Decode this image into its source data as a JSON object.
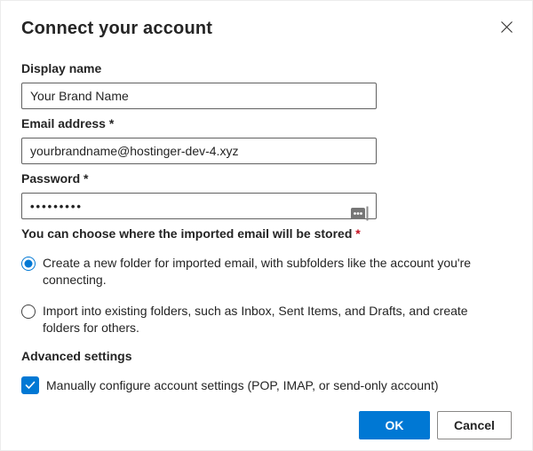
{
  "dialog": {
    "title": "Connect your account"
  },
  "fields": {
    "display_name": {
      "label": "Display name",
      "value": "Your Brand Name"
    },
    "email": {
      "label": "Email address",
      "required_mark": "*",
      "value": "yourbrandname@hostinger-dev-4.xyz"
    },
    "password": {
      "label": "Password",
      "required_mark": "*",
      "value": "•••••••••"
    }
  },
  "storage_section": {
    "heading": "You can choose where the imported email will be stored",
    "required_mark": "*",
    "options": [
      {
        "label": "Create a new folder for imported email, with subfolders like the account you're connecting.",
        "selected": true
      },
      {
        "label": "Import into existing folders, such as Inbox, Sent Items, and Drafts, and create folders for others.",
        "selected": false
      }
    ]
  },
  "advanced": {
    "heading": "Advanced settings",
    "checkbox_label": "Manually configure account settings (POP, IMAP, or send-only account)",
    "checked": true
  },
  "buttons": {
    "ok": "OK",
    "cancel": "Cancel"
  },
  "icons": {
    "close": "x-cross",
    "password_field": "credentials-ellipsis-cursor"
  },
  "colors": {
    "accent": "#0078d4",
    "required": "#c50f1f",
    "text": "#242424",
    "input_border": "#616161"
  }
}
